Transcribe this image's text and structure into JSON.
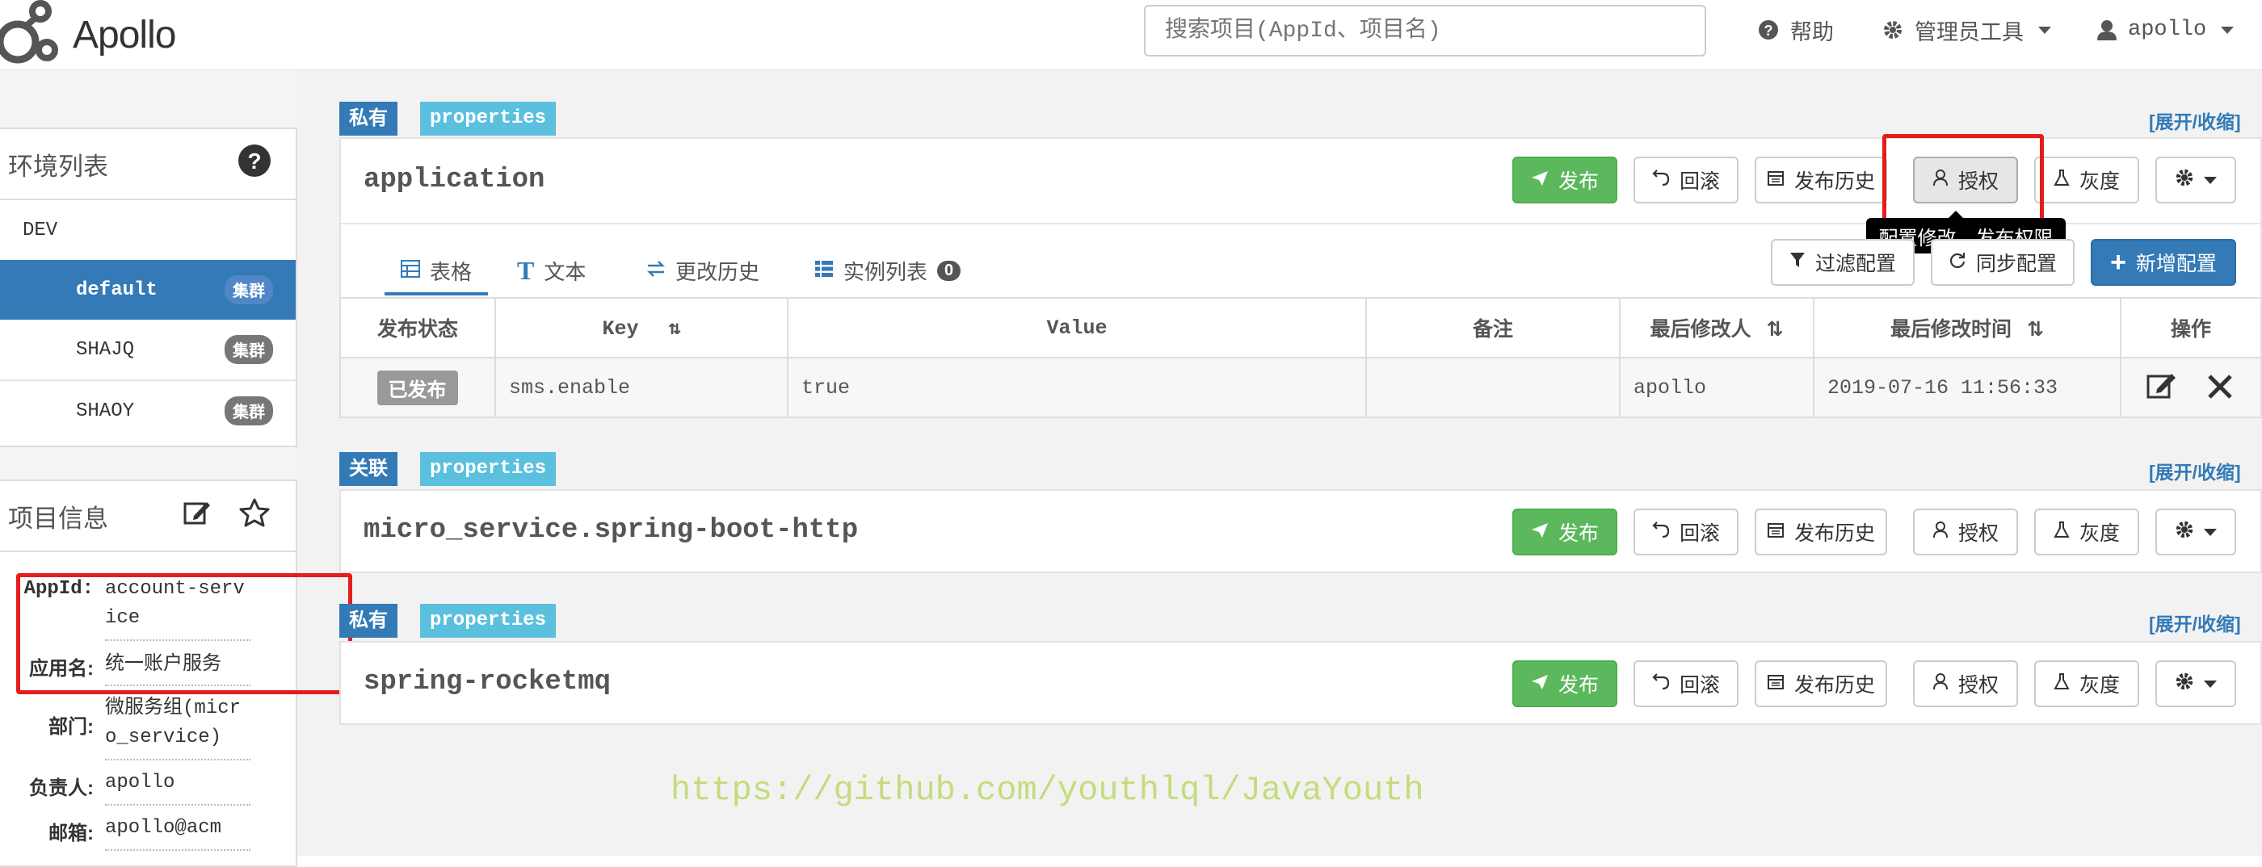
{
  "app": {
    "name": "Apollo"
  },
  "header": {
    "search_placeholder": "搜索项目(AppId、项目名)",
    "help_label": "帮助",
    "admin_tools_label": "管理员工具",
    "user_label": "apollo"
  },
  "env_panel": {
    "title": "环境列表",
    "env": "DEV",
    "clusters": [
      {
        "name": "default",
        "badge": "集群",
        "selected": true
      },
      {
        "name": "SHAJQ",
        "badge": "集群",
        "selected": false
      },
      {
        "name": "SHAOY",
        "badge": "集群",
        "selected": false
      }
    ]
  },
  "project_panel": {
    "title": "项目信息",
    "fields": [
      {
        "key": "AppId:",
        "value": "account-service"
      },
      {
        "key": "应用名:",
        "value": "统一账户服务"
      },
      {
        "key": "部门:",
        "value": "微服务组(micro_service)"
      },
      {
        "key": "负责人:",
        "value": "apollo"
      },
      {
        "key": "邮箱:",
        "value": "apollo@acm"
      }
    ]
  },
  "namespaces": [
    {
      "scope_tag": "私有",
      "format_tag": "properties",
      "toggle": "[展开/收缩]",
      "name": "application"
    },
    {
      "scope_tag": "关联",
      "format_tag": "properties",
      "toggle": "[展开/收缩]",
      "name": "micro_service.spring-boot-http"
    },
    {
      "scope_tag": "私有",
      "format_tag": "properties",
      "toggle": "[展开/收缩]",
      "name": "spring-rocketmq"
    }
  ],
  "actions": {
    "publish": "发布",
    "rollback": "回滚",
    "history": "发布历史",
    "grant": "授权",
    "gray": "灰度"
  },
  "tooltip": "配置修改、发布权限",
  "tabs": [
    {
      "label": "表格",
      "active": true
    },
    {
      "label": "文本",
      "active": false
    },
    {
      "label": "更改历史",
      "active": false
    },
    {
      "label": "实例列表",
      "active": false,
      "count": "0"
    }
  ],
  "table_actions": {
    "filter": "过滤配置",
    "sync": "同步配置",
    "add": "新增配置"
  },
  "table": {
    "headers": [
      "发布状态",
      "Key",
      "Value",
      "备注",
      "最后修改人",
      "最后修改时间",
      "操作"
    ],
    "rows": [
      {
        "status": "已发布",
        "key": "sms.enable",
        "value": "true",
        "comment": "",
        "modifier": "apollo",
        "time": "2019-07-16 11:56:33"
      }
    ]
  },
  "watermark": "https://github.com/youthlql/JavaYouth",
  "colors": {
    "primary": "#337ab7",
    "success": "#5cb85c",
    "info": "#5bc0de",
    "highlight": "#e41d1d"
  }
}
